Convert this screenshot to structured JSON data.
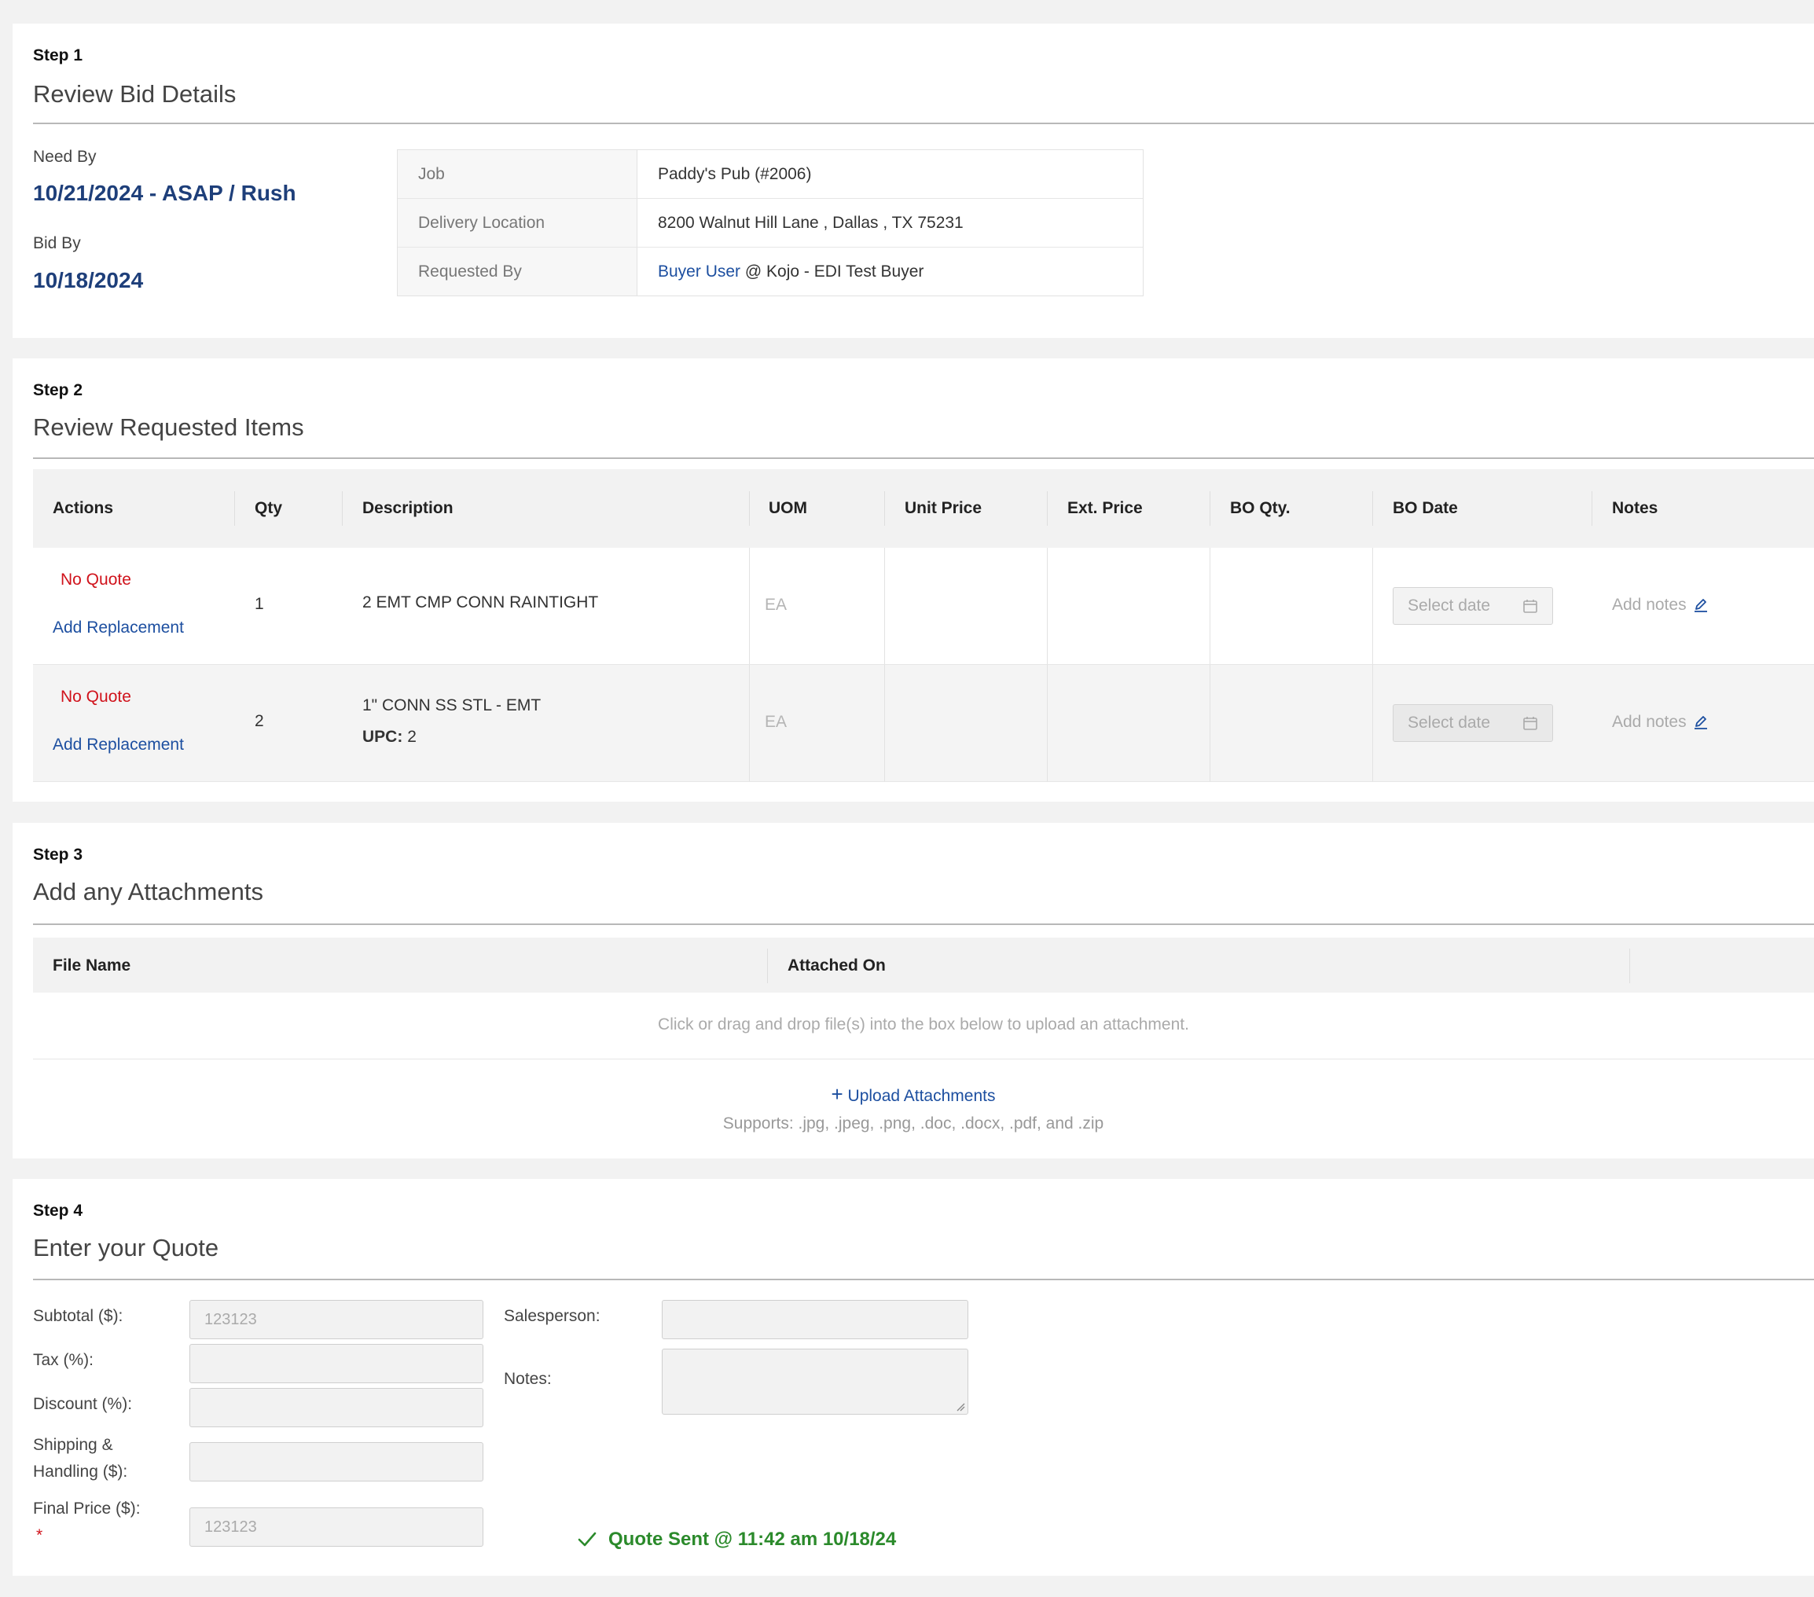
{
  "step1": {
    "step_label": "Step 1",
    "title": "Review Bid Details",
    "need_by_label": "Need By",
    "need_by_value": "10/21/2024 - ASAP / Rush",
    "bid_by_label": "Bid By",
    "bid_by_value": "10/18/2024",
    "details": {
      "job_label": "Job",
      "job_value": "Paddy's Pub (#2006)",
      "delivery_label": "Delivery Location",
      "delivery_value": "8200 Walnut Hill Lane , Dallas , TX 75231",
      "requested_label": "Requested By",
      "requested_user": "Buyer User",
      "requested_rest": "@ Kojo - EDI Test Buyer"
    }
  },
  "step2": {
    "step_label": "Step 2",
    "title": "Review Requested Items",
    "columns": [
      "Actions",
      "Qty",
      "Description",
      "UOM",
      "Unit Price",
      "Ext. Price",
      "BO Qty.",
      "BO Date",
      "Notes"
    ],
    "rows": [
      {
        "no_quote": "No Quote",
        "add_replacement": "Add Replacement",
        "qty": "1",
        "description": "2 EMT CMP CONN RAINTIGHT",
        "upc_label": "",
        "upc_value": "",
        "uom": "EA",
        "date_placeholder": "Select date",
        "notes": "Add notes"
      },
      {
        "no_quote": "No Quote",
        "add_replacement": "Add Replacement",
        "qty": "2",
        "description": "1\" CONN SS STL - EMT",
        "upc_label": "UPC:",
        "upc_value": "2",
        "uom": "EA",
        "date_placeholder": "Select date",
        "notes": "Add notes"
      }
    ]
  },
  "step3": {
    "step_label": "Step 3",
    "title": "Add any Attachments",
    "columns": [
      "File Name",
      "Attached On"
    ],
    "empty_message": "Click or drag and drop file(s) into the box below to upload an attachment.",
    "upload_label": "Upload Attachments",
    "supports": "Supports: .jpg, .jpeg, .png, .doc, .docx, .pdf, and .zip"
  },
  "step4": {
    "step_label": "Step 4",
    "title": "Enter your Quote",
    "subtotal_label": "Subtotal ($):",
    "subtotal_value": "123123",
    "tax_label": "Tax (%):",
    "discount_label": "Discount (%):",
    "shipping_label_1": "Shipping &",
    "shipping_label_2": "Handling ($):",
    "final_label": "Final Price ($):",
    "required_mark": "*",
    "final_value": "123123",
    "salesperson_label": "Salesperson:",
    "notes_label": "Notes:",
    "status": "Quote Sent @ 11:42 am 10/18/24"
  },
  "colors": {
    "link": "#1d4fa0",
    "date_blue": "#1e3f7a",
    "no_quote_red": "#d0121b",
    "success_green": "#2b8a2b"
  }
}
